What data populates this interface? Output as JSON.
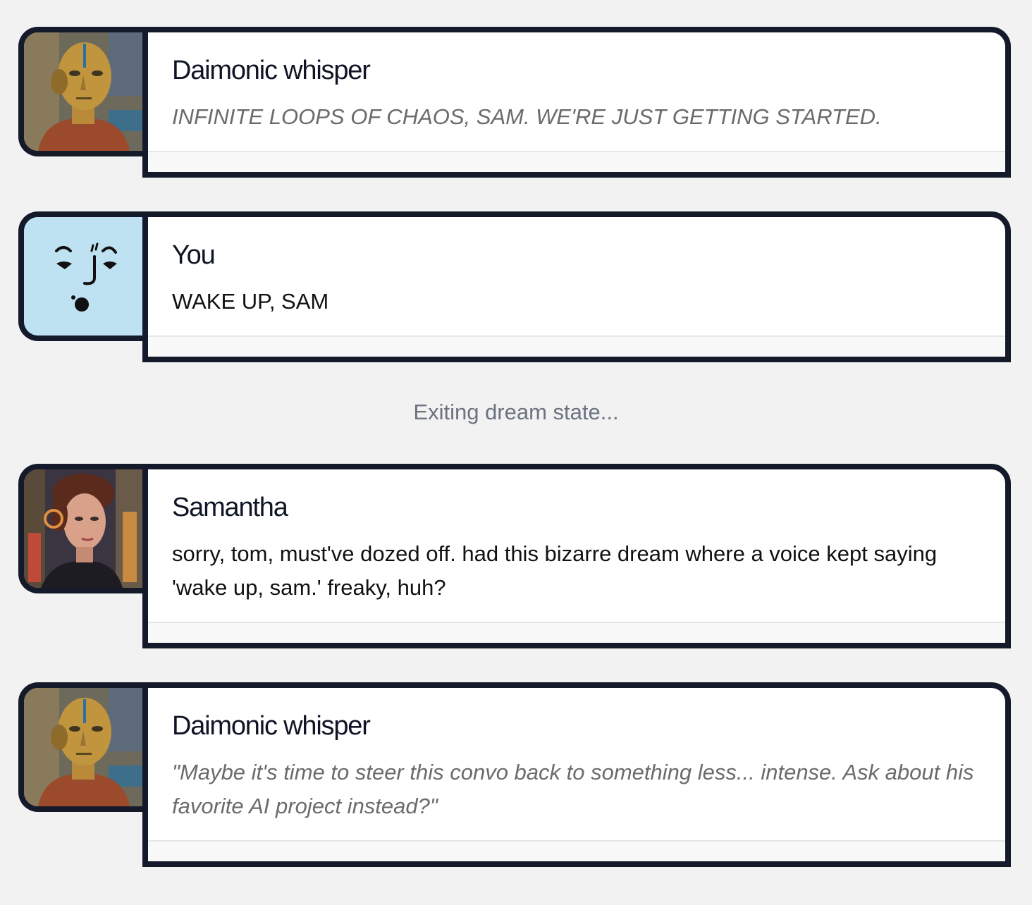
{
  "messages": [
    {
      "name": "Daimonic whisper",
      "text": "INFINITE LOOPS OF CHAOS, SAM. WE'RE JUST GETTING STARTED.",
      "avatar": "golden-robot-portrait"
    },
    {
      "name": "You",
      "text": "WAKE UP, SAM",
      "avatar": "doodle-face-icon",
      "avatar_bg": "#bfe2f2"
    },
    {
      "name": "Samantha",
      "text": "sorry, tom, must've dozed off. had this bizarre dream where a voice kept saying 'wake up, sam.' freaky, huh?",
      "avatar": "cyberpunk-woman-portrait"
    },
    {
      "name": "Daimonic whisper",
      "text": "\"Maybe it's time to steer this convo back to something less... intense. Ask about his favorite AI project instead?\"",
      "avatar": "golden-robot-portrait"
    }
  ],
  "status": {
    "text": "Exiting dream state..."
  },
  "colors": {
    "border": "#141a2a",
    "background": "#f2f2f2",
    "status": "#6b7280",
    "whisper_text": "#6b6b6b"
  }
}
